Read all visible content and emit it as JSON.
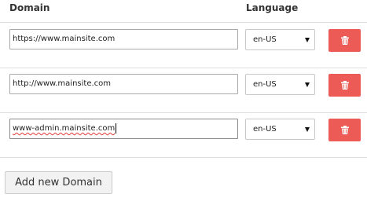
{
  "header": {
    "domain_label": "Domain",
    "language_label": "Language"
  },
  "rows": [
    {
      "domain": "https://www.mainsite.com",
      "language": "en-US",
      "delete_icon": "trash-icon"
    },
    {
      "domain": "http://www.mainsite.com",
      "language": "en-US",
      "delete_icon": "trash-icon"
    },
    {
      "domain": "www-admin.mainsite.com",
      "language": "en-US",
      "delete_icon": "trash-icon"
    }
  ],
  "add_button_label": "Add new Domain",
  "colors": {
    "delete_button": "#ec5b56",
    "spellcheck_underline": "#e53935"
  }
}
